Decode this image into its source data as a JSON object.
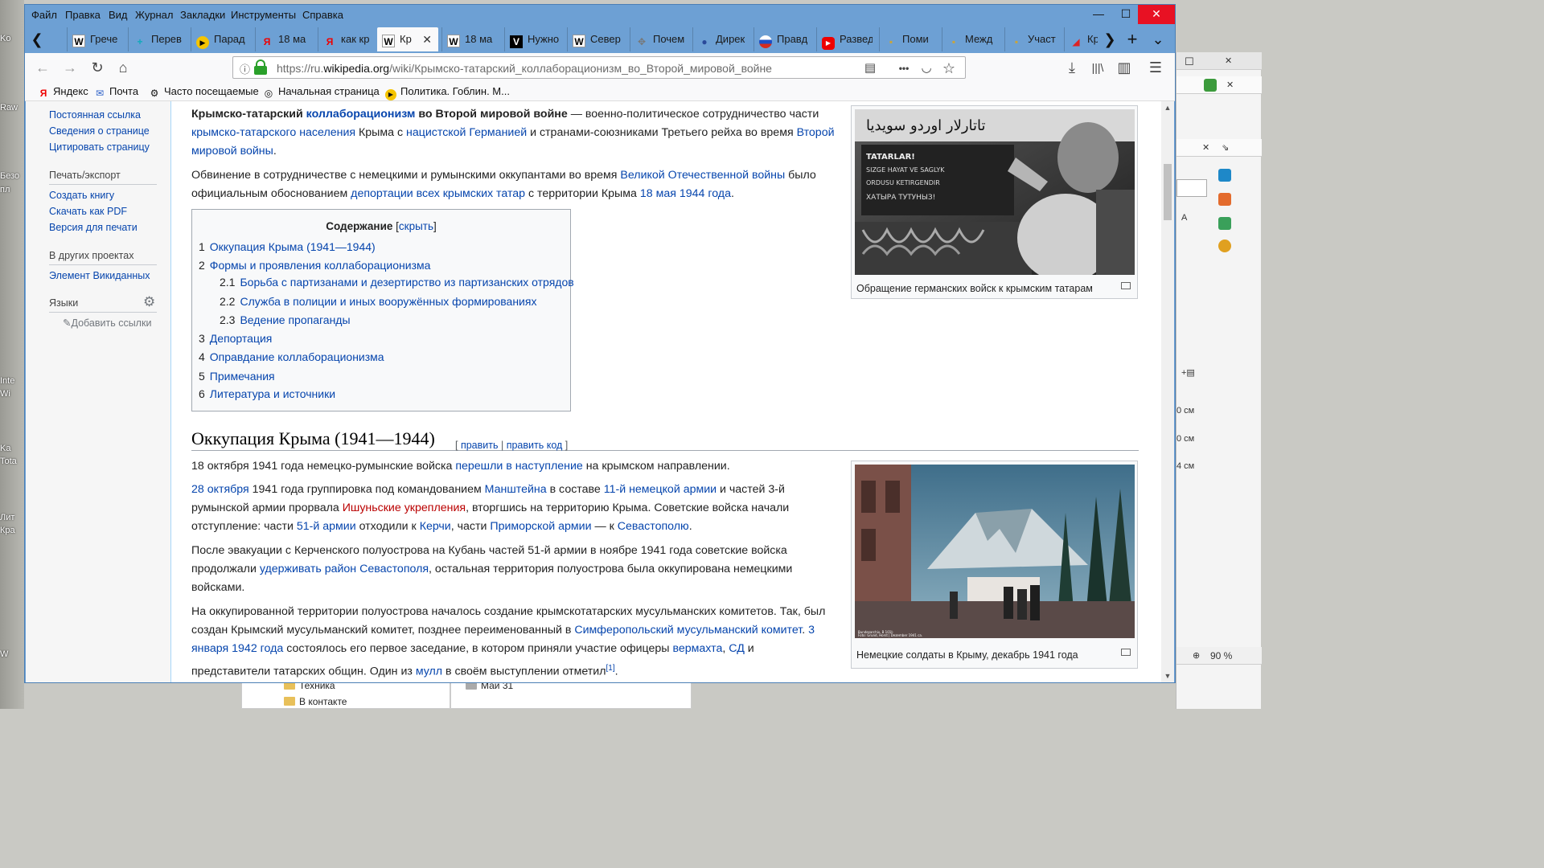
{
  "desktop": {
    "labels": [
      "Ko",
      "Raw",
      "Безо",
      "пл",
      "Inte",
      "Wi",
      "Ka",
      "Tota",
      "Лит",
      "Кра",
      "W"
    ],
    "bg_window": {
      "rows": [
        "0 см",
        "0 см",
        "4 см"
      ],
      "zoom": "90 %"
    },
    "bg_tree": {
      "items": [
        "Техника",
        "В контакте"
      ],
      "right_item": "Май 31"
    }
  },
  "menu": {
    "items": [
      "Файл",
      "Правка",
      "Вид",
      "Журнал",
      "Закладки",
      "Инструменты",
      "Справка"
    ],
    "minimize": "—",
    "maximize": "☐",
    "close": "✕"
  },
  "tabs": [
    {
      "title": "Грече",
      "icon": "W"
    },
    {
      "title": "Перев",
      "icon": "+"
    },
    {
      "title": "Парад",
      "icon": "▶"
    },
    {
      "title": "18 ма",
      "icon": "Я"
    },
    {
      "title": "как кр",
      "icon": "Я"
    },
    {
      "title": "Кр",
      "icon": "W",
      "active": true
    },
    {
      "title": "18 ма",
      "icon": "W"
    },
    {
      "title": "Нужно",
      "icon": "V"
    },
    {
      "title": "Север",
      "icon": "W"
    },
    {
      "title": "Почем",
      "icon": "✥"
    },
    {
      "title": "Дирек",
      "icon": "●"
    },
    {
      "title": "Правд",
      "icon": "●"
    },
    {
      "title": "Развед",
      "icon": "▶"
    },
    {
      "title": "Поми",
      "icon": "▪"
    },
    {
      "title": "Межд",
      "icon": "▪"
    },
    {
      "title": "Участ",
      "icon": "▪"
    },
    {
      "title": "Кр",
      "icon": "◢"
    }
  ],
  "tab_controls": {
    "scroll_left": "❮",
    "scroll_right": "❯",
    "new_tab": "+",
    "list": "⌄",
    "close": "✕"
  },
  "nav": {
    "back": "←",
    "forward": "→",
    "reload": "↻",
    "home": "⌂",
    "url_prefix": "https://ru.",
    "url_domain": "wikipedia.org",
    "url_path": "/wiki/Крымско-татарский_коллаборационизм_во_Второй_мировой_войне",
    "reader": "▤",
    "more": "•••",
    "pocket": "◡",
    "star": "☆",
    "download": "⤓",
    "library": "|||\\",
    "sidebar": "▥",
    "menu": "☰"
  },
  "bookmarks": [
    {
      "label": "Яндекс",
      "icon": "Я"
    },
    {
      "label": "Почта",
      "icon": "✉"
    },
    {
      "label": "Часто посещаемые",
      "icon": "⚙"
    },
    {
      "label": "Начальная страница",
      "icon": "◎"
    },
    {
      "label": "Политика. Гоблин. М...",
      "icon": "▶"
    }
  ],
  "sidebar": {
    "links_top": [
      "Постоянная ссылка",
      "Сведения о странице",
      "Цитировать страницу"
    ],
    "print_heading": "Печать/экспорт",
    "print_links": [
      "Создать книгу",
      "Скачать как PDF",
      "Версия для печати"
    ],
    "projects_heading": "В других проектах",
    "projects_links": [
      "Элемент Викиданных"
    ],
    "languages_heading": "Языки",
    "add_links": "Добавить ссылки"
  },
  "article": {
    "intro": {
      "b1": "Крымско-татарский ",
      "l1": "коллаборационизм",
      "b2": " во Второй мировой войне",
      "t1": " — военно-политическое сотрудничество части ",
      "l2": "крымско-татарского населения",
      "t2": " Крыма с ",
      "l3": "нацистской Германией",
      "t3": " и странами-союзниками Третьего рейха во время ",
      "l4": "Второй мировой войны",
      "t4": "."
    },
    "p2": {
      "t1": "Обвинение в сотрудничестве с немецкими и румынскими оккупантами во время ",
      "l1": "Великой Отечественной войны",
      "t2": " было официальным обоснованием ",
      "l2": "депортации всех крымских татар",
      "t3": " с территории Крыма ",
      "l3": "18 мая",
      "t4": " ",
      "l4": "1944 года",
      "t5": "."
    },
    "toc": {
      "title": "Содержание",
      "toggle_open": "[",
      "toggle": "скрыть",
      "toggle_close": "]",
      "items": [
        {
          "num": "1",
          "text": "Оккупация Крыма (1941—1944)"
        },
        {
          "num": "2",
          "text": "Формы и проявления коллаборационизма"
        },
        {
          "num": "2.1",
          "text": "Борьба с партизанами и дезертирство из партизанских отрядов"
        },
        {
          "num": "2.2",
          "text": "Служба в полиции и иных вооружённых формированиях"
        },
        {
          "num": "2.3",
          "text": "Ведение пропаганды"
        },
        {
          "num": "3",
          "text": "Депортация"
        },
        {
          "num": "4",
          "text": "Оправдание коллаборационизма"
        },
        {
          "num": "5",
          "text": "Примечания"
        },
        {
          "num": "6",
          "text": "Литература и источники"
        }
      ]
    },
    "section": {
      "title": "Оккупация Крыма (1941—1944)",
      "edit_open": "[ ",
      "edit": "править",
      "sep": " | ",
      "edit_code": "править код",
      "edit_close": " ]"
    },
    "s1": {
      "t1": "18 октября 1941 года немецко-румынские войска ",
      "l1": "перешли в наступление",
      "t2": " на крымском направлении."
    },
    "s2": {
      "l1": "28 октября",
      "t1": " 1941 года группировка под командованием ",
      "l2": "Манштейна",
      "t2": " в составе ",
      "l3": "11-й немецкой армии",
      "t3": " и частей 3-й румынской армии прорвала ",
      "n1": "Ишуньские укрепления",
      "t4": ", вторгшись на территорию Крыма. Советские войска начали отступление: части ",
      "l4": "51-й армии",
      "t5": " отходили к ",
      "l5": "Керчи",
      "t6": ", части ",
      "l6": "Приморской армии",
      "t7": " — к ",
      "l7": "Севастополю",
      "t8": "."
    },
    "s3": {
      "t1": "После эвакуации с Керченского полуострова на Кубань частей 51-й армии в ноябре 1941 года советские войска продолжали ",
      "l1": "удерживать район Севастополя",
      "t2": ", остальная территория полуострова была оккупирована немецкими войсками."
    },
    "s4": {
      "t1": "На оккупированной территории полуострова началось создание крымскотатарских мусульманских комитетов. Так, был создан Крымский мусульманский комитет, позднее переименованный в ",
      "l1": "Симферопольский мусульманский комитет",
      "t2": ". ",
      "l2": "3 января",
      "t3": " ",
      "l3": "1942 года",
      "t4": " состоялось его первое заседание, в котором приняли участие офицеры ",
      "l4": "вермахта",
      "t5": ", ",
      "l5": "СД",
      "t6": " и представители татарских общин. Один из ",
      "l6": "мулл",
      "t7": " в своём выступлении отметил",
      "ref": "[1]",
      "t8": "."
    },
    "figure1": {
      "caption": "Обращение германских войск к крымским татарам",
      "sign_lines": [
        "TATARLAR!",
        "SIZGE HAYAT VE SAGLYK",
        "ORDUSU KETIRGENDIR",
        "ХАТЫРА ТУТУНЫЗ!"
      ]
    },
    "figure2": {
      "caption": "Немецкие солдаты в Крыму, декабрь 1941 года",
      "credit_lines": [
        "Bundesarchiv, B 101I-",
        "Foto: Grund, Horst | Dezember 1941 ca."
      ]
    }
  }
}
